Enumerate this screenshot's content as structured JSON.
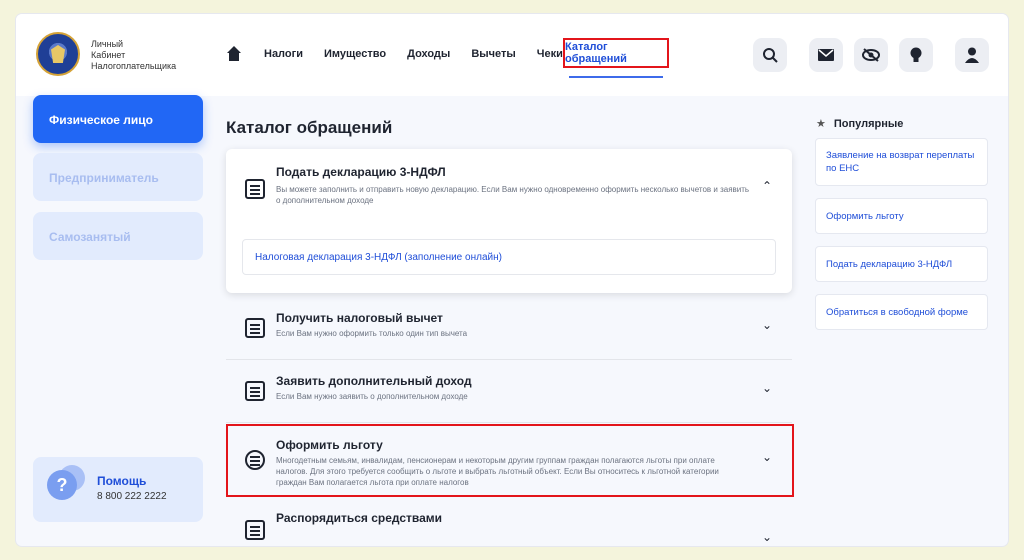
{
  "brand": {
    "line1": "Личный",
    "line2": "Кабинет",
    "line3": "Налогоплательщика"
  },
  "nav": {
    "items": [
      "Налоги",
      "Имущество",
      "Доходы",
      "Вычеты",
      "Чеки"
    ],
    "active": "Каталог обращений"
  },
  "header_icons": [
    "search-icon",
    "mail-icon",
    "hide-icon",
    "bulb-icon",
    "user-icon"
  ],
  "sidebar": {
    "items": [
      "Физическое лицо",
      "Предприниматель",
      "Самозанятый"
    ],
    "help_title": "Помощь",
    "help_phone": "8 800 222 2222"
  },
  "main": {
    "title": "Каталог обращений",
    "expanded": {
      "title": "Подать декларацию 3-НДФЛ",
      "desc": "Вы можете заполнить и отправить новую декларацию. Если Вам нужно одновременно оформить несколько вычетов и заявить о дополнительном доходе",
      "link": "Налоговая декларация 3-НДФЛ (заполнение онлайн)"
    },
    "rows": [
      {
        "title": "Получить налоговый вычет",
        "desc": "Если Вам нужно оформить только один тип вычета"
      },
      {
        "title": "Заявить дополнительный доход",
        "desc": "Если Вам нужно заявить о дополнительном доходе"
      },
      {
        "title": "Оформить льготу",
        "desc": "Многодетным семьям, инвалидам, пенсионерам и некоторым другим группам граждан полагаются льготы при оплате налогов. Для этого требуется сообщить о льготе и выбрать льготный объект. Если Вы относитесь к льготной категории граждан Вам полагается льгота при оплате налогов"
      },
      {
        "title": "Распорядиться средствами",
        "desc": ""
      }
    ]
  },
  "popular": {
    "title": "Популярные",
    "items": [
      "Заявление на возврат переплаты по ЕНС",
      "Оформить льготу",
      "Подать декларацию 3-НДФЛ",
      "Обратиться в свободной форме"
    ]
  }
}
